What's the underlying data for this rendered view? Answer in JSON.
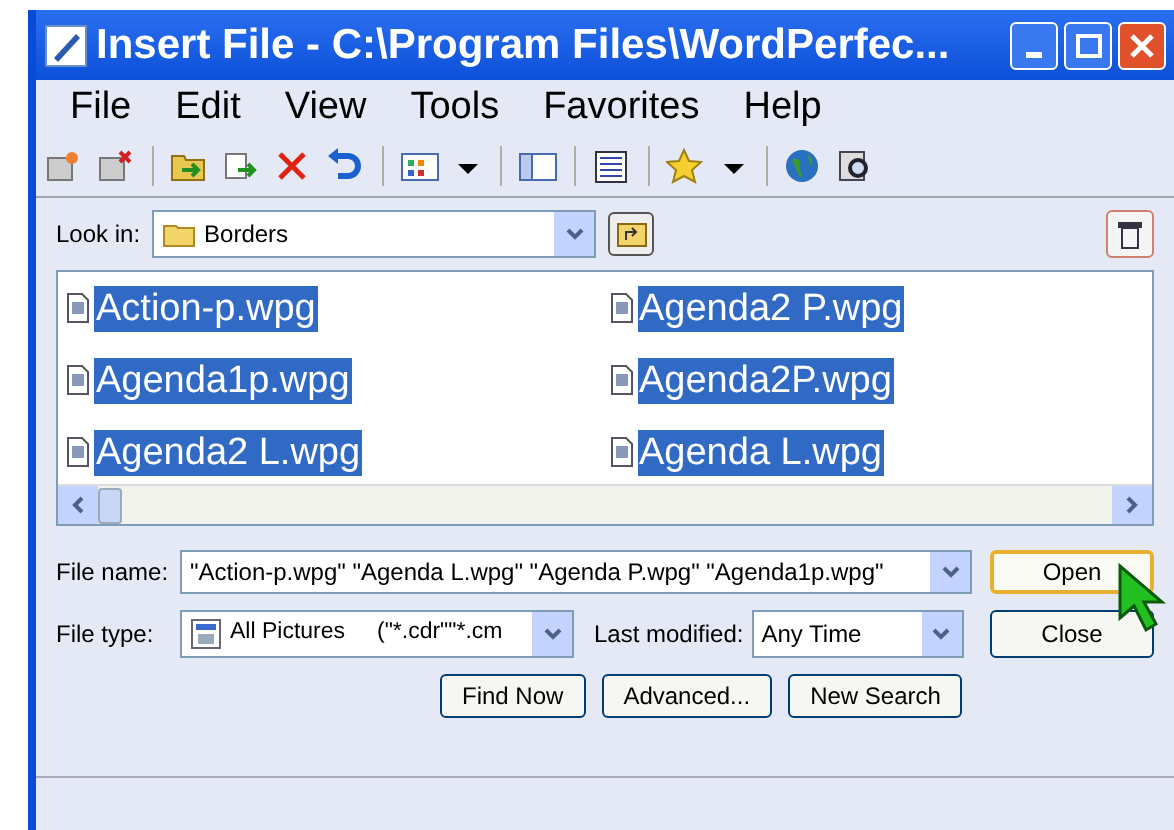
{
  "window": {
    "title": "Insert File - C:\\Program Files\\WordPerfec..."
  },
  "menu": [
    "File",
    "Edit",
    "View",
    "Tools",
    "Favorites",
    "Help"
  ],
  "look_in": {
    "label": "Look in:",
    "value": "Borders"
  },
  "files": [
    {
      "name": "Action-p.wpg",
      "selected": true
    },
    {
      "name": "Agenda1p.wpg",
      "selected": true
    },
    {
      "name": "Agenda2 L.wpg",
      "selected": true
    },
    {
      "name": "Agenda2 P.wpg",
      "selected": true
    },
    {
      "name": "Agenda2P.wpg",
      "selected": true
    },
    {
      "name": "Agenda L.wpg",
      "selected": true
    }
  ],
  "file_name": {
    "label": "File name:",
    "value": "\"Action-p.wpg\" \"Agenda L.wpg\" \"Agenda P.wpg\" \"Agenda1p.wpg\""
  },
  "file_type": {
    "label": "File type:",
    "value": "All Pictures     (\"*.cdr\"\"*.cm"
  },
  "last_modified": {
    "label": "Last modified:",
    "value": "Any Time"
  },
  "buttons": [
    {
      "label": "Open",
      "kind": "default"
    },
    {
      "label": "Close",
      "kind": "normal"
    }
  ],
  "search_buttons": [
    "Find Now",
    "Advanced...",
    "New Search"
  ]
}
